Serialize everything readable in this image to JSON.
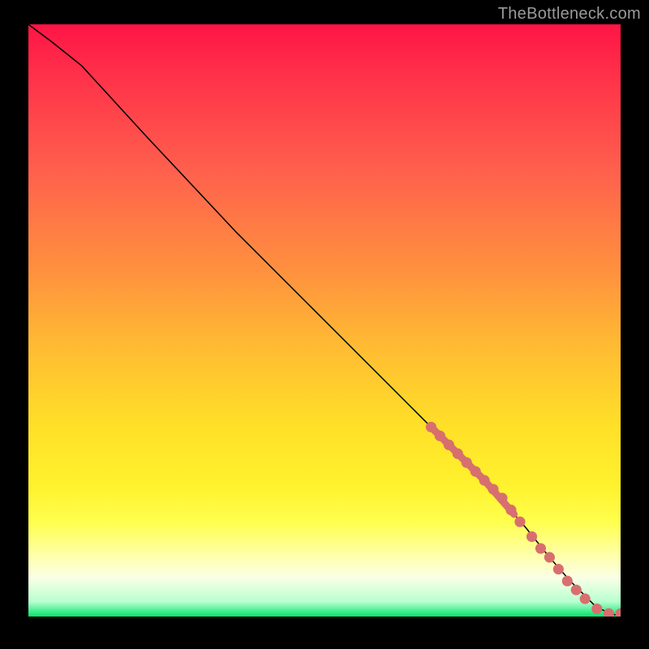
{
  "attribution": "TheBottleneck.com",
  "chart_data": {
    "type": "line",
    "title": "",
    "xlabel": "",
    "ylabel": "",
    "xlim": [
      0,
      100
    ],
    "ylim": [
      0,
      100
    ],
    "gradient_stops": [
      {
        "offset": 0,
        "color": "#ff1446"
      },
      {
        "offset": 8,
        "color": "#ff2f49"
      },
      {
        "offset": 25,
        "color": "#ff614d"
      },
      {
        "offset": 42,
        "color": "#ff923e"
      },
      {
        "offset": 55,
        "color": "#ffbd32"
      },
      {
        "offset": 68,
        "color": "#ffe028"
      },
      {
        "offset": 78,
        "color": "#fff22e"
      },
      {
        "offset": 84,
        "color": "#ffff4d"
      },
      {
        "offset": 90,
        "color": "#ffffb0"
      },
      {
        "offset": 93.5,
        "color": "#f9ffe6"
      },
      {
        "offset": 97.5,
        "color": "#b8ffd0"
      },
      {
        "offset": 100,
        "color": "#00e56a"
      }
    ],
    "series": [
      {
        "name": "bottleneck-curve",
        "x": [
          0,
          4,
          9,
          20,
          35,
          50,
          65,
          77,
          84,
          88,
          91.5,
          94,
          96,
          99,
          100
        ],
        "y": [
          100,
          97,
          93,
          81,
          65,
          50,
          35,
          23,
          15,
          10,
          6,
          3.5,
          1.5,
          0.3,
          0.3
        ]
      }
    ],
    "highlighted_range": {
      "x_start": 68,
      "x_end": 82
    },
    "highlighted_points": [
      {
        "x": 68,
        "y": 32
      },
      {
        "x": 69.5,
        "y": 30.5
      },
      {
        "x": 71,
        "y": 29
      },
      {
        "x": 72.5,
        "y": 27.5
      },
      {
        "x": 74,
        "y": 26
      },
      {
        "x": 75.5,
        "y": 24.5
      },
      {
        "x": 77,
        "y": 23
      },
      {
        "x": 78.5,
        "y": 21.5
      },
      {
        "x": 80,
        "y": 20
      },
      {
        "x": 81.5,
        "y": 18
      },
      {
        "x": 83,
        "y": 16
      },
      {
        "x": 85,
        "y": 13.5
      },
      {
        "x": 86.5,
        "y": 11.5
      },
      {
        "x": 88,
        "y": 10
      },
      {
        "x": 89.5,
        "y": 8
      },
      {
        "x": 91,
        "y": 6
      },
      {
        "x": 92.5,
        "y": 4.5
      },
      {
        "x": 94,
        "y": 3
      },
      {
        "x": 96,
        "y": 1.3
      },
      {
        "x": 98,
        "y": 0.5
      },
      {
        "x": 100,
        "y": 0.5
      }
    ],
    "dot_color": "#d86f6f",
    "curve_color": "#000000"
  }
}
